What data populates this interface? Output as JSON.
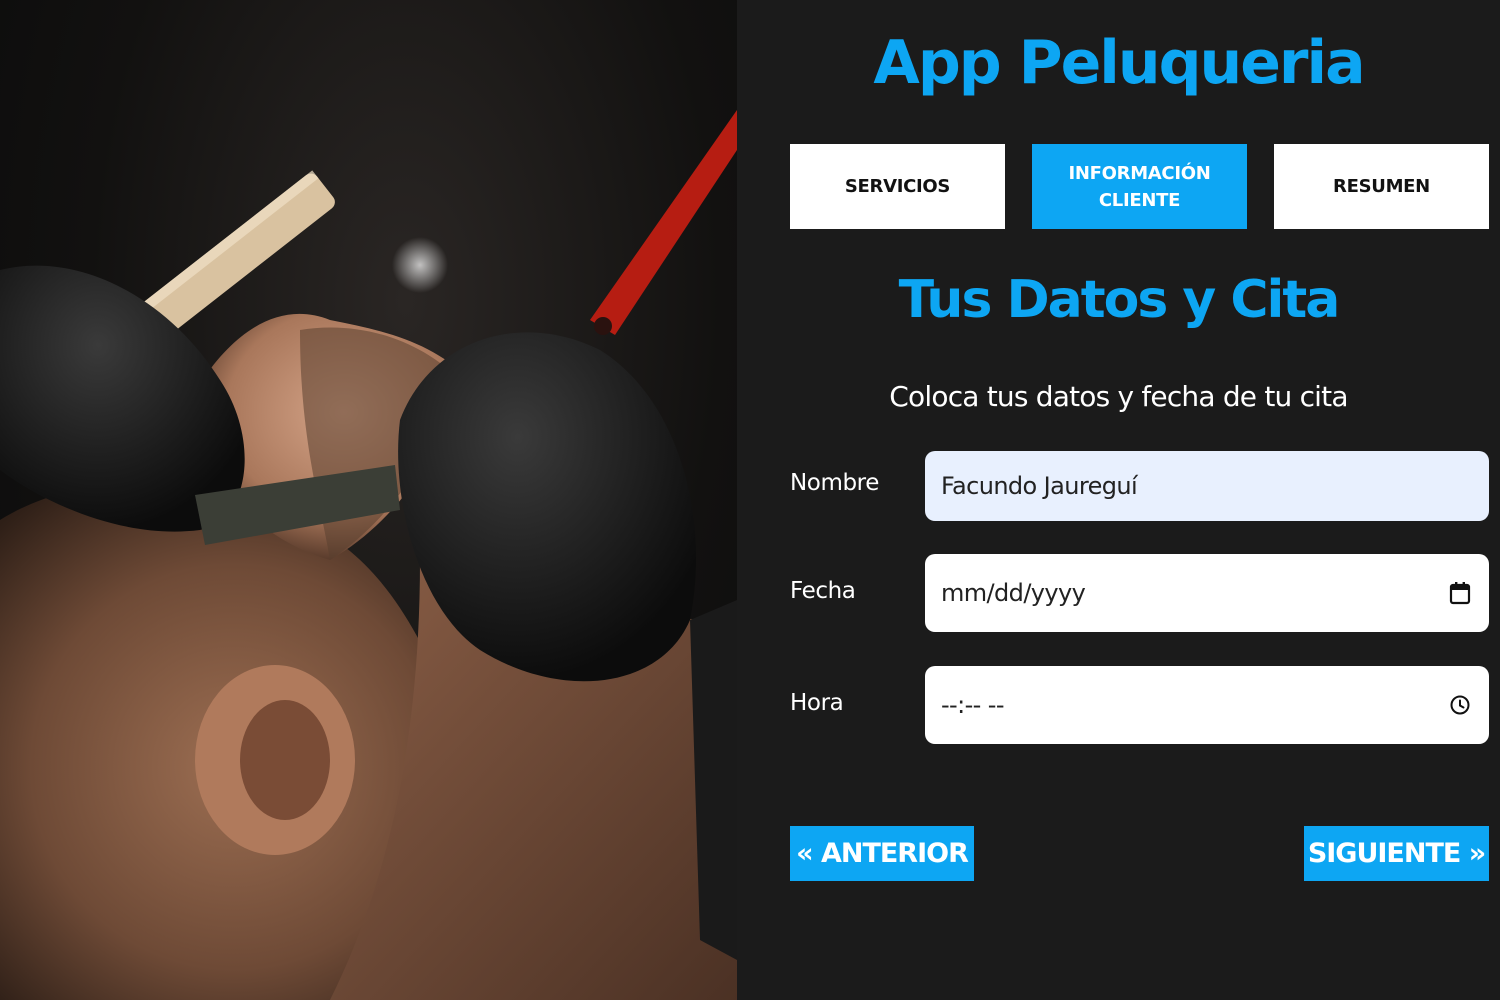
{
  "header": {
    "title": "App Peluqueria"
  },
  "tabs": [
    {
      "label": "Servicios",
      "active": false
    },
    {
      "label": "Información Cliente",
      "active": true
    },
    {
      "label": "Resumen",
      "active": false
    }
  ],
  "section": {
    "title": "Tus Datos y Cita",
    "description": "Coloca tus datos y fecha de tu cita"
  },
  "form": {
    "nombre": {
      "label": "Nombre",
      "value": "Facundo Jaureguí"
    },
    "fecha": {
      "label": "Fecha",
      "placeholder": "mm/dd/yyyy",
      "icon": "calendar-icon"
    },
    "hora": {
      "label": "Hora",
      "placeholder": "--:-- --",
      "icon": "clock-icon"
    }
  },
  "nav": {
    "prev_label": "« Anterior",
    "next_label": "Siguiente »"
  },
  "colors": {
    "accent": "#0da6f3",
    "background": "#1b1b1b",
    "autofill": "#e8f0fe"
  }
}
